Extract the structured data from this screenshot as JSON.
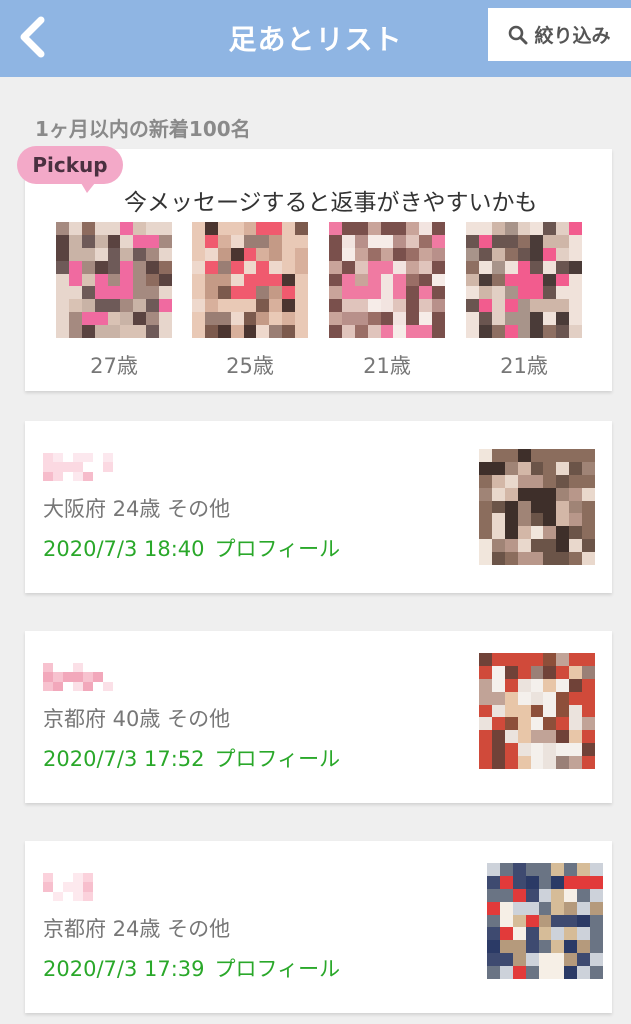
{
  "header": {
    "title": "足あとリスト",
    "filter_label": "絞り込み",
    "bg_color": "#8fb5e3"
  },
  "section": {
    "label": "1ヶ月以内の新着100名"
  },
  "pickup": {
    "badge": "Pickup",
    "message": "今メッセージすると返事がきやすいかも",
    "users": [
      {
        "age": "27歳"
      },
      {
        "age": "25歳"
      },
      {
        "age": "21歳"
      },
      {
        "age": "21歳"
      }
    ]
  },
  "footprints": [
    {
      "meta": "大阪府 24歳 その他",
      "time": "2020/7/3 18:40",
      "profile": "プロフィール"
    },
    {
      "meta": "京都府 40歳 その他",
      "time": "2020/7/3 17:52",
      "profile": "プロフィール"
    },
    {
      "meta": "京都府 24歳 その他",
      "time": "2020/7/3 17:39",
      "profile": "プロフィール"
    }
  ],
  "colors": {
    "accent_green": "#2aa82a",
    "pickup_pink": "#f3a9c8"
  }
}
